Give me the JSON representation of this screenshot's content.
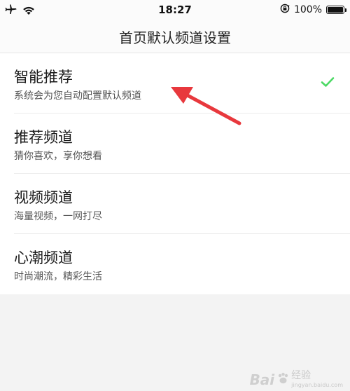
{
  "status_bar": {
    "time": "18:27",
    "battery_percent": "100%",
    "battery_level": 1.0
  },
  "header": {
    "title": "首页默认频道设置"
  },
  "channels": [
    {
      "title": "智能推荐",
      "subtitle": "系统会为您自动配置默认频道",
      "selected": true
    },
    {
      "title": "推荐频道",
      "subtitle": "猜你喜欢，享你想看",
      "selected": false
    },
    {
      "title": "视频频道",
      "subtitle": "海量视频，一网打尽",
      "selected": false
    },
    {
      "title": "心潮频道",
      "subtitle": "时尚潮流，精彩生活",
      "selected": false
    }
  ],
  "icons": {
    "airplane": "airplane-icon",
    "wifi": "wifi-icon",
    "orientation_lock": "orientation-lock-icon",
    "battery": "battery-icon",
    "check": "checkmark-icon"
  },
  "colors": {
    "accent_check": "#4cd964",
    "annotation_arrow": "#e8383d"
  },
  "watermark": {
    "logo": "Bai",
    "name": "经验",
    "url": "jingyan.baidu.com"
  }
}
